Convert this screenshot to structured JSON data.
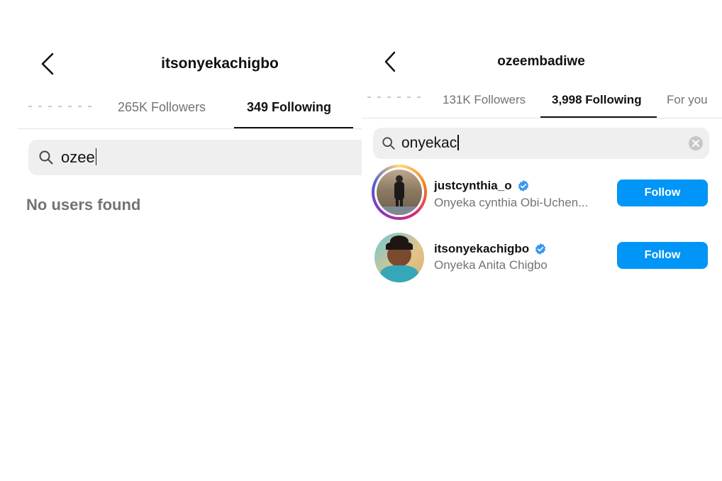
{
  "left": {
    "title": "itsonyekachigbo",
    "tabs": [
      {
        "label": "265K Followers"
      },
      {
        "label": "349 Following",
        "active": true
      }
    ],
    "search": {
      "query": "ozee"
    },
    "empty_message": "No users found"
  },
  "right": {
    "title": "ozeembadiwe",
    "tabs": [
      {
        "label": "131K Followers"
      },
      {
        "label": "3,998 Following",
        "active": true
      },
      {
        "label": "For you"
      }
    ],
    "search": {
      "query": "onyekac"
    },
    "results": [
      {
        "username": "justcynthia_o",
        "full_name": "Onyeka cynthia Obi-Uchen...",
        "verified": true,
        "button": "Follow"
      },
      {
        "username": "itsonyekachigbo",
        "full_name": "Onyeka Anita Chigbo",
        "verified": true,
        "button": "Follow"
      }
    ]
  },
  "colors": {
    "accent": "#0095f6",
    "verified": "#3797f0",
    "secondary_text": "#737373",
    "search_bg": "#efefef"
  },
  "icons": [
    "back-arrow-icon",
    "search-icon",
    "clear-icon",
    "verified-badge-icon"
  ]
}
